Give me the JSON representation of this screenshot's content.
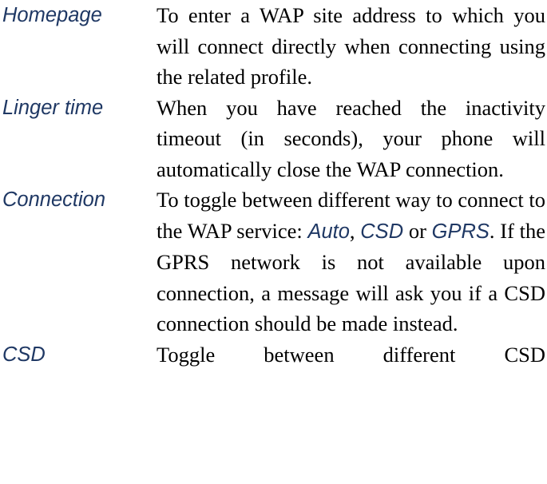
{
  "document": {
    "type": "definition-list",
    "background_color": "#ffffff",
    "term_color": "#1f3864",
    "description_color": "#000000",
    "rows": [
      {
        "term": "Homepage",
        "description": "To enter a WAP site address to which you will connect directly when connecting using the related profile."
      },
      {
        "term": "Linger time",
        "description": "When you have reached the inactivity timeout (in seconds), your phone will automatically close the WAP connection."
      },
      {
        "term": "Connection",
        "description_part1": "To toggle between different way to connect to the WAP service: ",
        "keyword1": "Auto",
        "punct1": ", ",
        "keyword2": "CSD",
        "description_part2": " or ",
        "keyword3": "GPRS",
        "description_part3": ". If the GPRS network is not available upon connection, a message will ask you if a CSD connection should be made instead."
      },
      {
        "term": "CSD",
        "description": "Toggle between different CSD"
      }
    ]
  }
}
